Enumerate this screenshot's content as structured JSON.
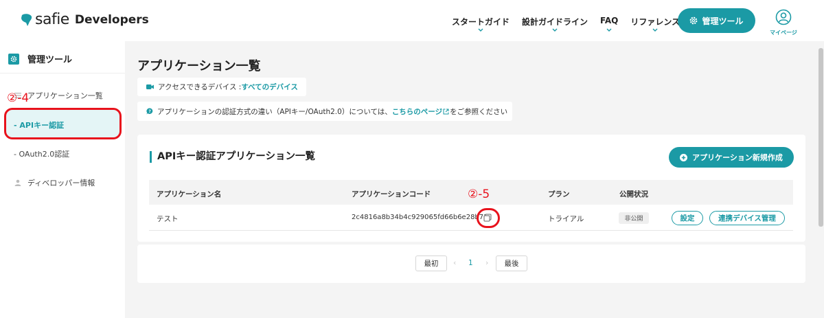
{
  "header": {
    "logo_brand": "safie",
    "logo_suffix": "Developers",
    "nav": [
      {
        "label": "スタートガイド"
      },
      {
        "label": "設計ガイドライン"
      },
      {
        "label": "FAQ"
      },
      {
        "label": "リファレンス"
      }
    ],
    "mgmt_button": "管理ツール",
    "mypage": "マイページ"
  },
  "sidebar": {
    "title": "管理ツール",
    "items": [
      {
        "label": "アプリケーション一覧"
      },
      {
        "label": "- APIキー認証",
        "active": true
      },
      {
        "label": "- OAuth2.0認証"
      },
      {
        "label": "ディベロッパー情報"
      }
    ]
  },
  "annotations": {
    "a1": "②-4",
    "a2": "②-5"
  },
  "main": {
    "page_title": "アプリケーション一覧",
    "device_info_prefix": "アクセスできるデバイス : ",
    "device_info_link": "すべてのデバイス",
    "auth_note_prefix": "アプリケーションの認証方式の違い（APIキー/OAuth2.0）については、",
    "auth_note_link": "こちらのページ",
    "auth_note_suffix": "をご参照ください",
    "card_title": "APIキー認証アプリケーション一覧",
    "create_button": "アプリケーション新規作成",
    "table": {
      "headers": [
        "アプリケーション名",
        "アプリケーションコード",
        "プラン",
        "公開状況"
      ],
      "rows": [
        {
          "name": "テスト",
          "code": "2c4816a8b34b4c929065fd66b6e28b71",
          "plan": "トライアル",
          "status": "非公開",
          "settings_button": "設定",
          "device_button": "連携デバイス管理"
        }
      ]
    },
    "pagination": {
      "first": "最初",
      "last": "最後",
      "current_page": "1",
      "prev": "‹",
      "next": "›"
    }
  },
  "colors": {
    "accent": "#1b9aa5",
    "annotation": "#e8121c",
    "background": "#f4f4f4"
  }
}
